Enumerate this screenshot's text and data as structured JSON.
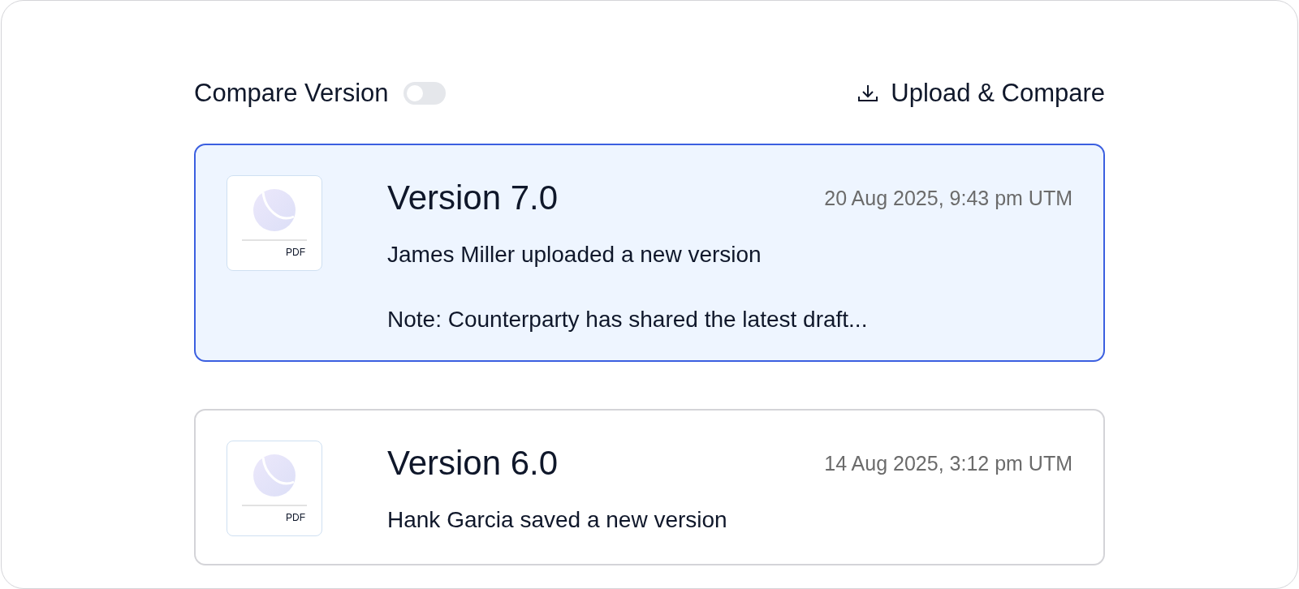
{
  "compare_version": {
    "label": "Compare Version",
    "on": false
  },
  "upload_button": {
    "label": "Upload & Compare"
  },
  "versions": [
    {
      "file_type": "PDF",
      "title": "Version 7.0",
      "date": "20 Aug 2025, 9:43 pm UTM",
      "activity": "James Miller uploaded a new version",
      "note": "Note: Counterparty has shared the latest draft...",
      "selected": true
    },
    {
      "file_type": "PDF",
      "title": "Version 6.0",
      "date": "14 Aug 2025, 3:12 pm UTM",
      "activity": "Hank Garcia saved a new version",
      "selected": false
    }
  ]
}
